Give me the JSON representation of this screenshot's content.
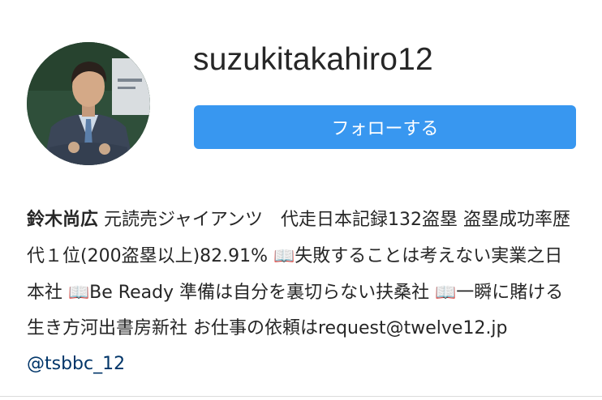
{
  "profile": {
    "username": "suzukitakahiro12",
    "follow_button": "フォローする"
  },
  "bio": {
    "name": "鈴木尚広",
    "text1": " 元読売ジャイアンツ　代走日本記録132盗塁 盗塁成功率歴代１位(200盗塁以上)82.91% ",
    "book_icon": "📖",
    "text2": "失敗することは考えない実業之日本社 ",
    "text3": "Be Ready 準備は自分を裏切らない扶桑社 ",
    "text4": "一瞬に賭ける生き方河出書房新社 お仕事の依頼はrequest@twelve12.jp ",
    "mention": "@tsbbc_12"
  },
  "colors": {
    "follow_button_bg": "#3897f0",
    "mention": "#003569",
    "text": "#262626"
  }
}
